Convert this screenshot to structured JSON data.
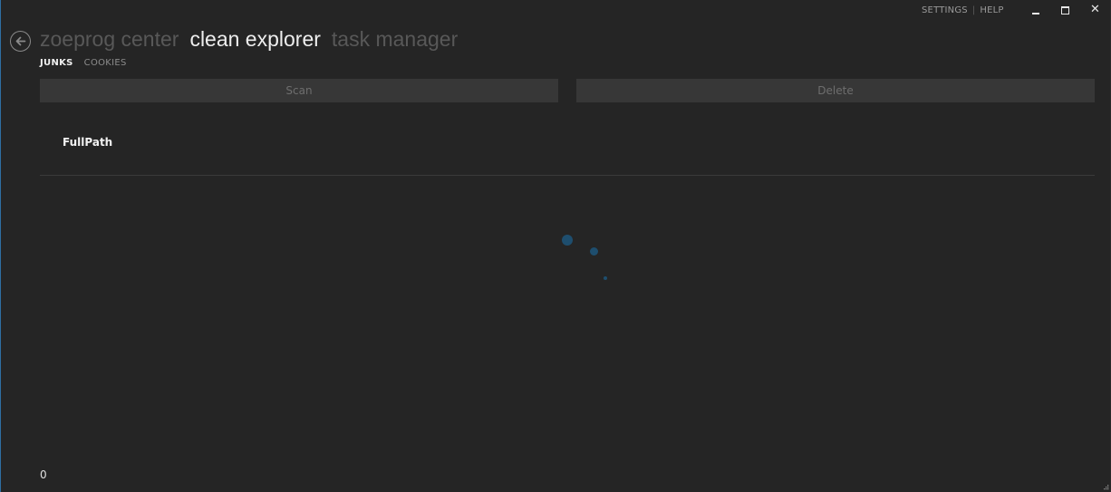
{
  "top_commands": {
    "settings_label": "SETTINGS",
    "separator": "|",
    "help_label": "HELP"
  },
  "window_controls": {
    "close_glyph": "✕"
  },
  "titles": {
    "app1": "zoeprog center",
    "app2": "clean explorer",
    "app3": "task manager"
  },
  "pivots": {
    "junks": "JUNKS",
    "cookies": "COOKIES"
  },
  "actions": {
    "scan_label": "Scan",
    "delete_label": "Delete"
  },
  "grid": {
    "columns": [
      "FullPath"
    ]
  },
  "status": {
    "count": "0"
  },
  "colors": {
    "background": "#252525",
    "accent": "#1e4e6e",
    "button_bg": "#373737"
  },
  "icons": {
    "back": "back-arrow-icon",
    "minimize": "minimize-icon",
    "maximize": "maximize-icon",
    "close": "close-icon",
    "progress": "progress-ring-icon",
    "resize": "resize-grip-icon"
  }
}
